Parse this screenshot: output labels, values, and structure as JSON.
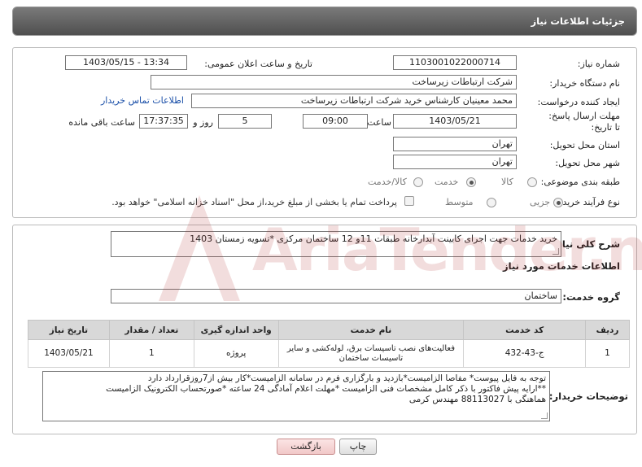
{
  "header": {
    "title": "جزئیات اطلاعات نیاز"
  },
  "form": {
    "need_number_label": "شماره نیاز:",
    "need_number": "1103001022000714",
    "announce_label": "تاریخ و ساعت اعلان عمومی:",
    "announce_value": "1403/05/15 - 13:34",
    "buyer_org_label": "نام دستگاه خریدار:",
    "buyer_org": "شرکت ارتباطات زیرساخت",
    "creator_label": "ایجاد کننده درخواست:",
    "creator": "محمد معینیان کارشناس خرید شرکت ارتباطات زیرساخت",
    "contact_link": "اطلاعات تماس خریدار",
    "deadline_label": "مهلت ارسال پاسخ: تا تاریخ:",
    "deadline_date": "1403/05/21",
    "time_label": "ساعت",
    "deadline_time": "09:00",
    "days_value": "5",
    "days_label": "روز و",
    "remaining_time": "17:37:35",
    "remaining_label": "ساعت باقی مانده",
    "province_label": "استان محل تحویل:",
    "province": "تهران",
    "city_label": "شهر محل تحویل:",
    "city": "تهران",
    "category_label": "طبقه بندی موضوعی:",
    "category_options": [
      "کالا",
      "خدمت",
      "کالا/خدمت"
    ],
    "category_selected": 1,
    "process_label": "نوع فرآیند خرید :",
    "process_options": [
      "جزیی",
      "متوسط"
    ],
    "process_selected": 0,
    "payment_note": "پرداخت تمام یا بخشی از مبلغ خرید،از محل \"اسناد خزانه اسلامی\" خواهد بود."
  },
  "description": {
    "label": "شرح کلی نیاز:",
    "value": "خرید خدمات جهت اجرای کابینت آبدارخانه طبقات 11و 12 ساختمان مرکزی *تسویه زمستان 1403"
  },
  "services": {
    "section_title": "اطلاعات خدمات مورد نیاز",
    "group_label": "گروه خدمت:",
    "group_value": "ساختمان",
    "columns": [
      "ردیف",
      "کد خدمت",
      "نام خدمت",
      "واحد اندازه گیری",
      "تعداد / مقدار",
      "تاریخ نیاز"
    ],
    "rows": [
      {
        "row": "1",
        "code": "ج-43-432",
        "name": "فعالیت‌های نصب تاسیسات برق، لوله‌کشی و سایر تاسیسات ساختمان",
        "unit": "پروژه",
        "qty": "1",
        "date": "1403/05/21"
      }
    ]
  },
  "buyer_notes": {
    "label": "توضیحات خریدار:",
    "line1": "توجه به فایل پیوست* مفاصا الزامیست*بازدید و بارگزاری فرم در سامانه الزامیست*کار بیش از7روزقرارداد دارد",
    "line2": "**ارایه پیش فاکتور با ذکر کامل مشخصات فنی الزامیست *مهلت اعلام آمادگی 24 ساعته *صورتحساب الکترونیک الزامیست",
    "line3": "هماهنگی با 88113027 مهندس کرمی"
  },
  "buttons": {
    "print": "چاپ",
    "back": "بازگشت"
  },
  "watermark": {
    "text": "AriaTender.neT"
  },
  "colors": {
    "header_bg": "#5f5f5f",
    "link": "#1a4fa8",
    "table_header": "#d8d8d8",
    "back_button": "#f1c8c8"
  }
}
